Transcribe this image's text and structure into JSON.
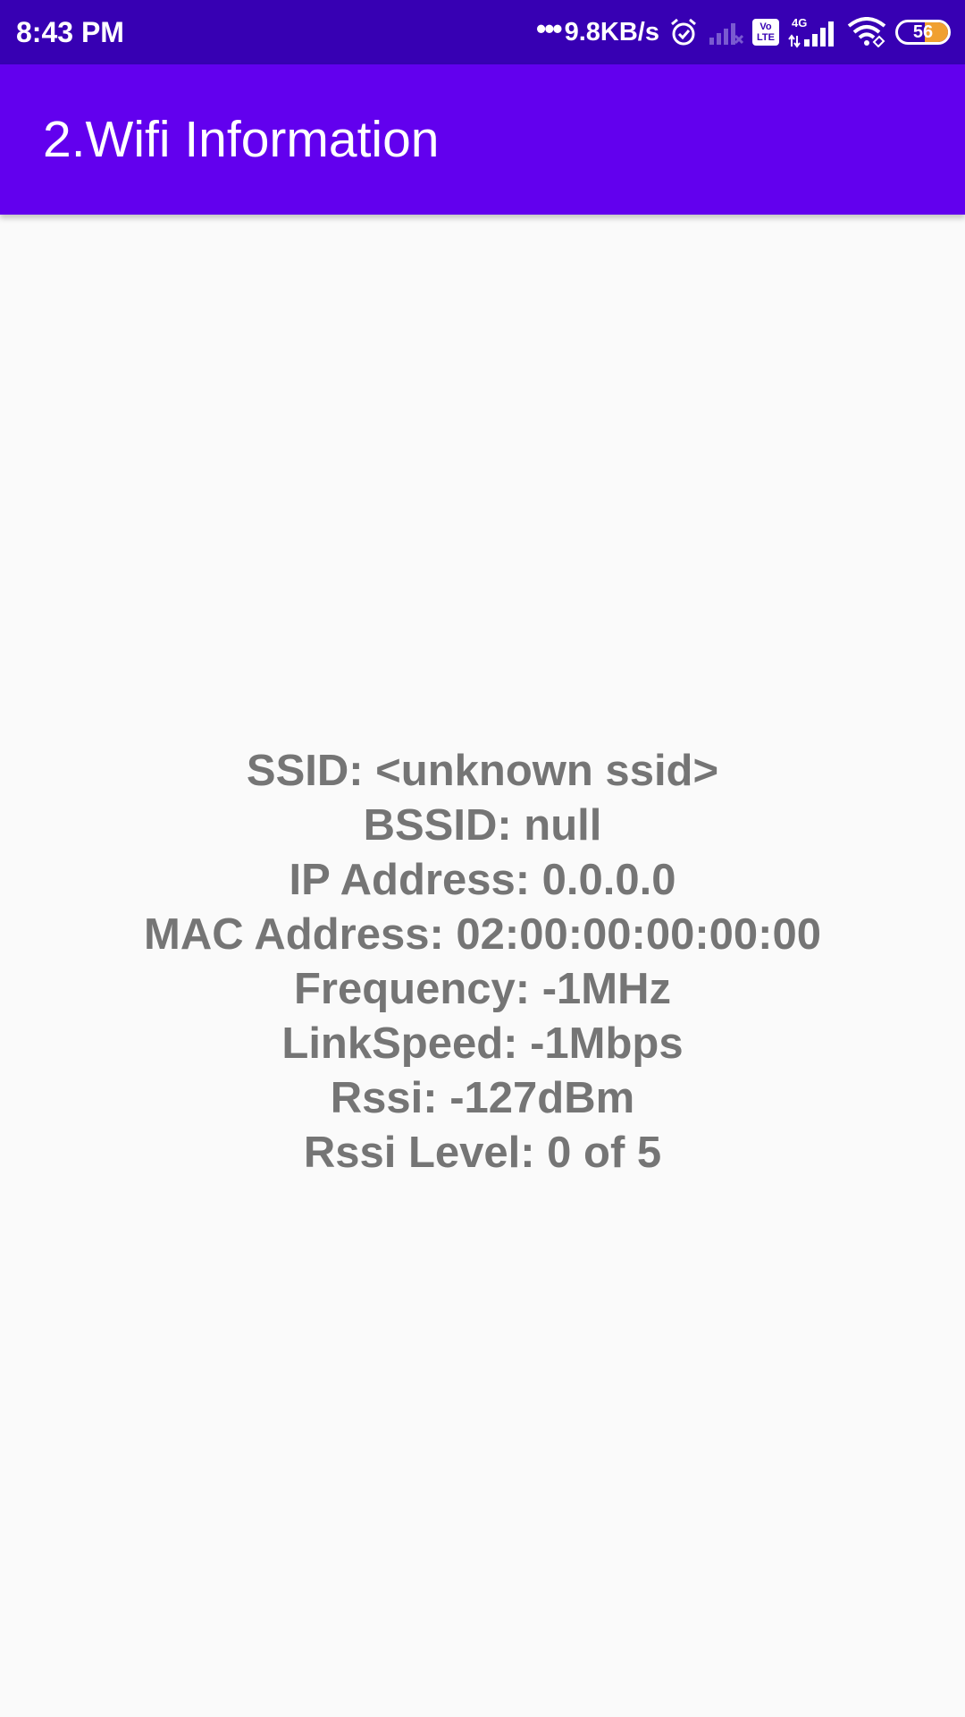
{
  "status_bar": {
    "time": "8:43 PM",
    "net_dots": "•••",
    "net_speed": "9.8KB/s",
    "volte_line1": "Vo",
    "volte_line2": "LTE",
    "network_type": "4G",
    "battery_level": "56",
    "icons": [
      "alarm-icon",
      "signal-off-icon",
      "volte-icon",
      "signal-4g-icon",
      "wifi-icon",
      "battery-icon"
    ]
  },
  "app_bar": {
    "title": "2.Wifi Information",
    "color": "#6200ee"
  },
  "wifi_info": {
    "ssid": "SSID: <unknown ssid>",
    "bssid": "BSSID: null",
    "ip_address": "IP Address: 0.0.0.0",
    "mac_address": "MAC Address: 02:00:00:00:00:00",
    "frequency": "Frequency: -1MHz",
    "link_speed": "LinkSpeed: -1Mbps",
    "rssi": "Rssi: -127dBm",
    "rssi_level": "Rssi Level: 0 of 5"
  },
  "colors": {
    "status_bar": "#3700b3",
    "app_bar": "#6200ee",
    "background": "#fafafa",
    "text": "#757575"
  }
}
